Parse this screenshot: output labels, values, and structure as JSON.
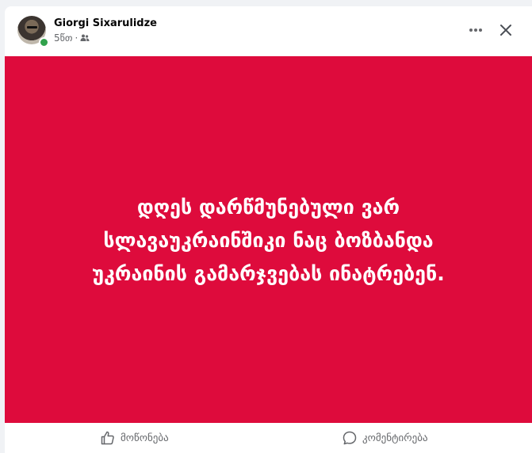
{
  "post": {
    "author": "Giorgi Sixarulidze",
    "time": "5წთ",
    "separator": "·",
    "audience_icon": "friends-icon",
    "background_color": "#de0b3c",
    "text_lines": [
      "დღეს დარწმუნებული ვარ",
      "სლავაუკრაინშიკი ნაც ბოზბანდა",
      "უკრაინის გამარჯვებას ინატრებენ."
    ]
  },
  "header": {
    "more_icon": "more-horizontal-icon",
    "close_icon": "close-icon"
  },
  "actions": {
    "like_label": "მოწონება",
    "comment_label": "კომენტირება"
  }
}
